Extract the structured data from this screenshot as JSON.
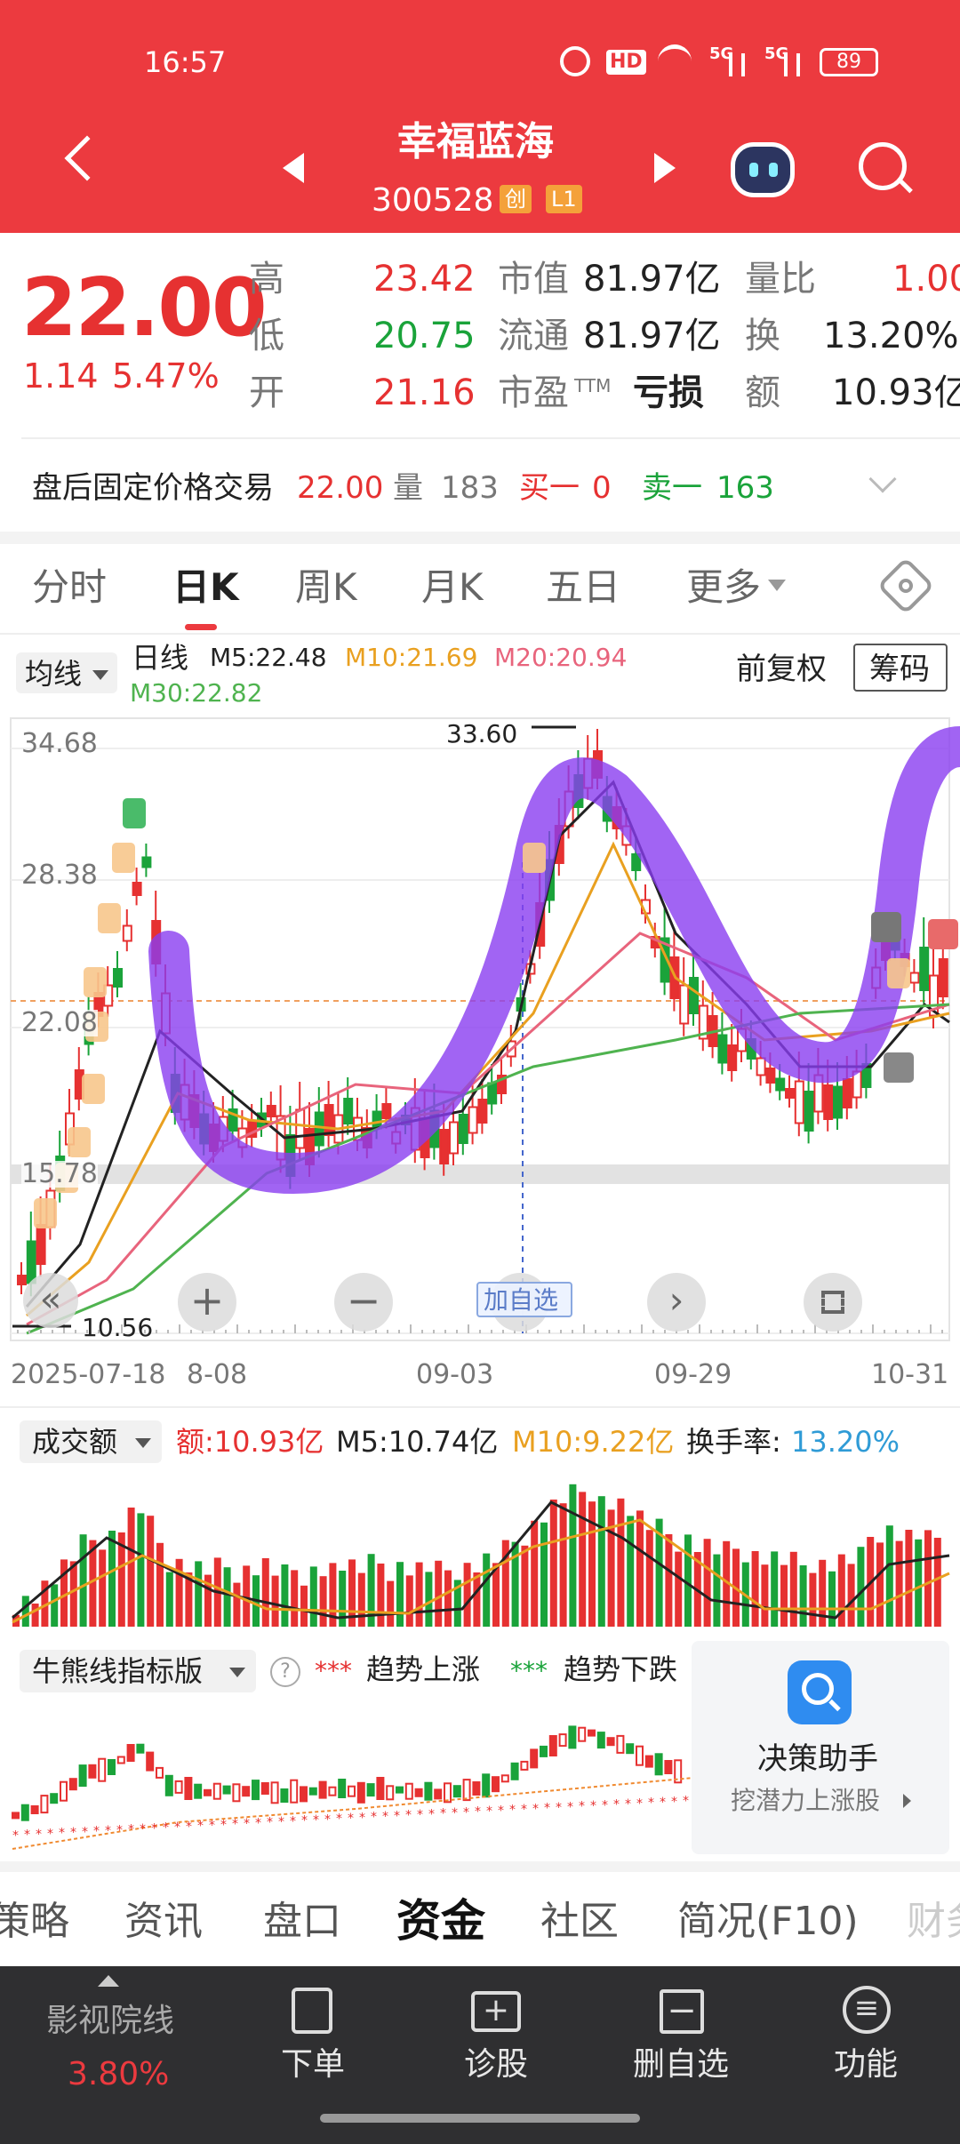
{
  "status": {
    "time": "16:57",
    "battery": "89",
    "hd": "HD",
    "sig1": "5G",
    "sig2": "5G"
  },
  "stock": {
    "name": "幸福蓝海",
    "code": "300528",
    "badge1": "创",
    "badge2": "L1"
  },
  "quote": {
    "price": "22.00",
    "change": "1.14",
    "pct": "5.47%",
    "high_label": "高",
    "high": "23.42",
    "low_label": "低",
    "low": "20.75",
    "open_label": "开",
    "open": "21.16",
    "mcap_label": "市值",
    "mcap": "81.97亿",
    "float_label": "流通",
    "float": "81.97亿",
    "pe_label": "市盈",
    "pe_tm": "TTM",
    "pe": "亏损",
    "vr_label": "量比",
    "vr": "1.00",
    "turn_label": "换",
    "turn": "13.20%",
    "amt_label": "额",
    "amt": "10.93亿"
  },
  "after": {
    "label": "盘后固定价格交易",
    "price": "22.00",
    "vol_label": "量",
    "vol": "183",
    "buy_label": "买一",
    "buy": "0",
    "sell_label": "卖一",
    "sell": "163"
  },
  "tabs": [
    {
      "label": "分时"
    },
    {
      "label": "日K"
    },
    {
      "label": "周K"
    },
    {
      "label": "月K"
    },
    {
      "label": "五日"
    },
    {
      "label": "更多"
    }
  ],
  "kline": {
    "ma_btn": "均线",
    "period": "日线",
    "m5": "M5:22.48",
    "m10": "M10:21.69",
    "m20": "M20:20.94",
    "m30": "M30:22.82",
    "adjust": "前复权",
    "chip": "筹码",
    "y1": "34.68",
    "y2": "28.38",
    "y3": "22.08",
    "y4": "15.78",
    "max_label": "33.60",
    "min_label": "10.56",
    "add_watch": "加自选",
    "d1": "2025-07-18",
    "d2": "8-08",
    "d3": "09-03",
    "d4": "09-29",
    "d5": "10-31",
    "buy_mark": "B",
    "sell_mark": "S"
  },
  "volume": {
    "label": "成交额",
    "amt": "额:10.93亿",
    "m5": "M5:10.74亿",
    "m10": "M10:9.22亿",
    "turn_label": "换手率:",
    "turn": "13.20%"
  },
  "indicator": {
    "label": "牛熊线指标版",
    "up": "趋势上涨",
    "down": "趋势下跌"
  },
  "assistant": {
    "title": "决策助手",
    "sub": "挖潜力上涨股"
  },
  "bottom_tabs": [
    "策略",
    "资讯",
    "盘口",
    "资金",
    "社区",
    "简况(F10)",
    "财务"
  ],
  "nav": {
    "sector": "影视院线",
    "sector_pct": "3.80%",
    "order": "下单",
    "diag": "诊股",
    "remove": "删自选",
    "func": "功能"
  },
  "colors": {
    "header": "#ec3a3f",
    "up": "#e63131",
    "down": "#1aa33a",
    "m5": "#222222",
    "m10": "#e9a020",
    "m20": "#e8647c",
    "m30": "#4fb34f"
  }
}
